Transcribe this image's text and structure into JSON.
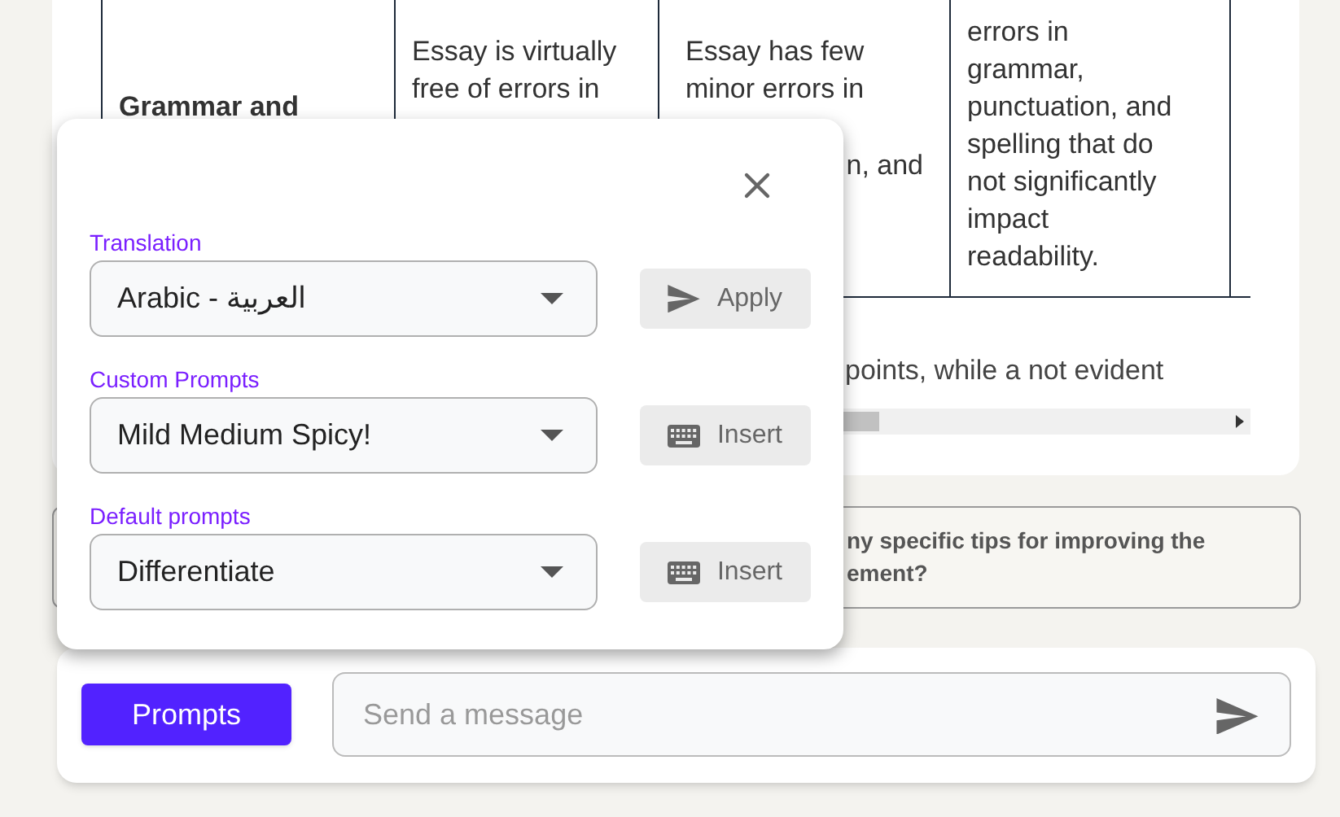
{
  "table": {
    "cells": [
      {
        "lines": [
          "Grammar and"
        ]
      },
      {
        "lines": [
          "Essay is virtually",
          "free of errors in"
        ]
      },
      {
        "lines": [
          "Essay has few",
          "minor errors in",
          "n, and"
        ]
      },
      {
        "lines": [
          "errors in",
          "grammar,",
          "punctuation, and",
          "spelling that do",
          "not significantly",
          "impact",
          "readability."
        ]
      }
    ]
  },
  "paragraph": "points, while a not evident",
  "suggestion": "ny specific tips for improving the ement?",
  "popup": {
    "sections": [
      {
        "label": "Translation",
        "value": "Arabic - العربية",
        "button": {
          "kind": "send",
          "label": "Apply"
        }
      },
      {
        "label": "Custom Prompts",
        "value": "Mild Medium Spicy!",
        "button": {
          "kind": "keyboard",
          "label": "Insert"
        }
      },
      {
        "label": "Default prompts",
        "value": "Differentiate",
        "button": {
          "kind": "keyboard",
          "label": "Insert"
        }
      }
    ]
  },
  "chat": {
    "button": "Prompts",
    "placeholder": "Send a message"
  }
}
